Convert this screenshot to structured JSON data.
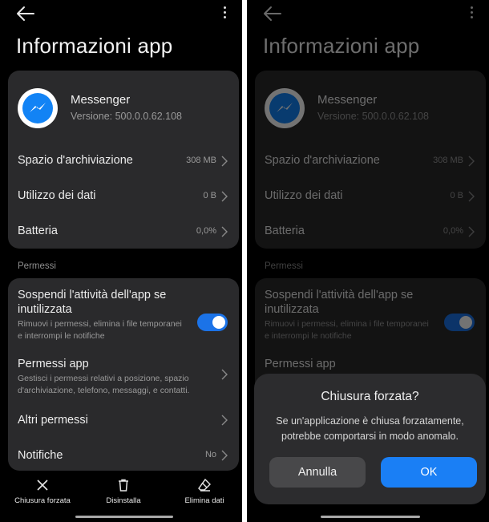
{
  "page": {
    "title": "Informazioni app",
    "app": {
      "name": "Messenger",
      "version": "Versione: 500.0.0.62.108",
      "icon": "messenger-icon"
    },
    "info_rows": [
      {
        "label": "Spazio d'archiviazione",
        "value": "308 MB"
      },
      {
        "label": "Utilizzo dei dati",
        "value": "0 B"
      },
      {
        "label": "Batteria",
        "value": "0,0%"
      }
    ],
    "section_label": "Permessi",
    "permissions": {
      "pause_label": "Sospendi l'attività dell'app se inutilizzata",
      "pause_desc": "Rimuovi i permessi, elimina i file temporanei e interrompi le notifiche",
      "pause_enabled": true,
      "app_perms_label": "Permessi app",
      "app_perms_desc": "Gestisci i permessi relativi a posizione, spazio d'archiviazione, telefono, messaggi, e contatti.",
      "other_label": "Altri permessi",
      "notif_label": "Notifiche",
      "notif_value": "No"
    },
    "bottom": {
      "force_stop": "Chiusura forzata",
      "uninstall": "Disinstalla",
      "clear_data": "Elimina dati"
    }
  },
  "dialog": {
    "title": "Chiusura forzata?",
    "message": "Se un'applicazione è chiusa forzatamente, potrebbe comportarsi in modo anomalo.",
    "cancel": "Annulla",
    "ok": "OK"
  },
  "colors": {
    "background": "#000000",
    "card": "#2a2a2c",
    "accent": "#1a7ff5",
    "messenger_blue": "#1283f5"
  }
}
